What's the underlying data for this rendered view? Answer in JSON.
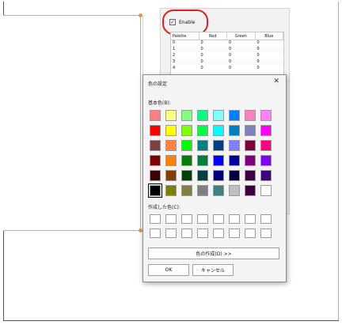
{
  "settings": {
    "enable_label": "Enable",
    "enable_checked_glyph": "✓",
    "table": {
      "headers": [
        "Palette",
        "Red",
        "Green",
        "Blue"
      ],
      "rows": [
        [
          "0",
          "0",
          "0",
          "0"
        ],
        [
          "1",
          "0",
          "0",
          "0"
        ],
        [
          "2",
          "0",
          "0",
          "0"
        ],
        [
          "3",
          "0",
          "0",
          "0"
        ],
        [
          "4",
          "0",
          "0",
          "0"
        ]
      ]
    }
  },
  "dialog": {
    "title": "色の設定",
    "close_glyph": "✕",
    "basic_colors_label": "基本色(B):",
    "custom_colors_label": "作成した色(C):",
    "define_custom_label": "色の作成(D) >>",
    "ok_label": "OK",
    "cancel_label": "キャンセル",
    "basic_colors": [
      "#ff8080",
      "#ffff80",
      "#80ff80",
      "#00ff80",
      "#80ffff",
      "#0080ff",
      "#ff80c0",
      "#ff80ff",
      "#ff0000",
      "#ffff00",
      "#80ff00",
      "#00ff40",
      "#00ffff",
      "#0080c0",
      "#8080c0",
      "#ff00ff",
      "#804040",
      "#ff8040",
      "#00ff00",
      "#008080",
      "#004080",
      "#8080ff",
      "#800040",
      "#ff0080",
      "#800000",
      "#ff8000",
      "#008000",
      "#008040",
      "#0000ff",
      "#0000a0",
      "#800080",
      "#8000ff",
      "#400000",
      "#804000",
      "#004000",
      "#004040",
      "#000080",
      "#000040",
      "#400040",
      "#400080",
      "#000000",
      "#808000",
      "#808040",
      "#808080",
      "#408080",
      "#c0c0c0",
      "#400040",
      "#ffffff"
    ],
    "selected_basic_index": 40,
    "custom_color_count": 16
  }
}
